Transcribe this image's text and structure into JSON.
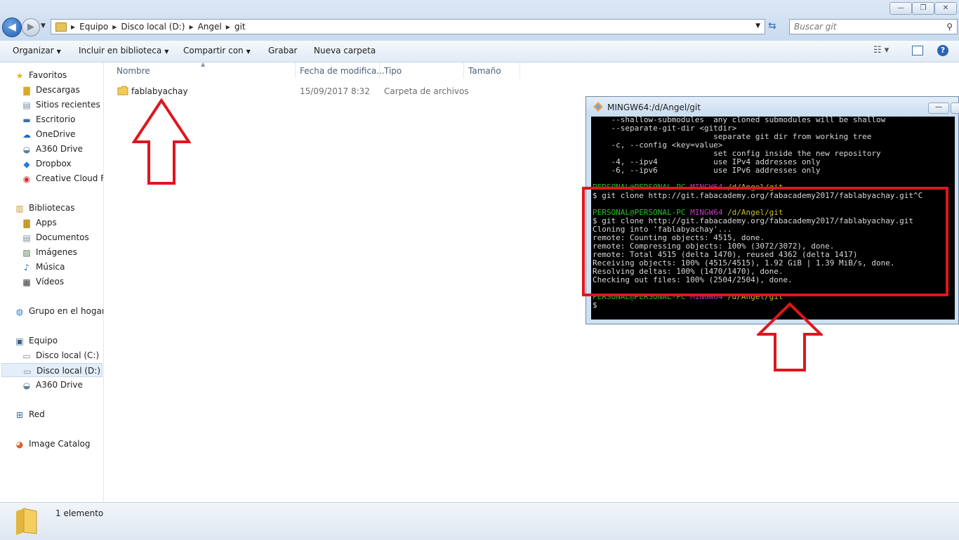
{
  "window": {
    "controls": {
      "minimize": "—",
      "maximize": "❐",
      "close": "✕"
    }
  },
  "address_bar": {
    "crumbs": [
      "Equipo",
      "Disco local (D:)",
      "Angel",
      "git"
    ],
    "search_placeholder": "Buscar git"
  },
  "toolbar": {
    "organize": "Organizar",
    "include_library": "Incluir en biblioteca",
    "share": "Compartir con",
    "burn": "Grabar",
    "new_folder": "Nueva carpeta"
  },
  "sidebar": {
    "favorites": {
      "label": "Favoritos",
      "items": [
        "Descargas",
        "Sitios recientes",
        "Escritorio",
        "OneDrive",
        "A360 Drive",
        "Dropbox",
        "Creative Cloud Files"
      ]
    },
    "libraries": {
      "label": "Bibliotecas",
      "items": [
        "Apps",
        "Documentos",
        "Imágenes",
        "Música",
        "Vídeos"
      ]
    },
    "homegroup": "Grupo en el hogar",
    "computer": {
      "label": "Equipo",
      "items": [
        "Disco local (C:)",
        "Disco local (D:)",
        "A360 Drive"
      ]
    },
    "network": "Red",
    "image_catalog": "Image Catalog"
  },
  "file_list": {
    "columns": [
      "Nombre",
      "Fecha de modifica...",
      "Tipo",
      "Tamaño"
    ],
    "rows": [
      {
        "name": "fablabyachay",
        "date": "15/09/2017 8:32",
        "type": "Carpeta de archivos",
        "size": ""
      }
    ]
  },
  "status_bar": {
    "count": "1 elemento"
  },
  "terminal": {
    "title": "MINGW64:/d/Angel/git",
    "prompt_user": "PERSONAL@PERSONAL-PC",
    "prompt_env": "MINGW64",
    "prompt_path": "/d/Angel/git",
    "help_lines": [
      "    --shallow-submodules  any cloned submodules will be shallow",
      "    --separate-git-dir <gitdir>",
      "                          separate git dir from working tree",
      "    -c, --config <key=value>",
      "                          set config inside the new repository",
      "    -4, --ipv4            use IPv4 addresses only",
      "    -6, --ipv6            use IPv6 addresses only"
    ],
    "command_cancelled": "$ git clone http://git.fabacademy.org/fabacademy2017/fablabyachay.git^C",
    "command": "$ git clone http://git.fabacademy.org/fabacademy2017/fablabyachay.git",
    "output_lines": [
      "Cloning into 'fablabyachay'...",
      "remote: Counting objects: 4515, done.",
      "remote: Compressing objects: 100% (3072/3072), done.",
      "remote: Total 4515 (delta 1470), reused 4362 (delta 1417)",
      "Receiving objects: 100% (4515/4515), 1.92 GiB | 1.39 MiB/s, done.",
      "Resolving deltas: 100% (1470/1470), done.",
      "Checking out files: 100% (2504/2504), done."
    ],
    "cursor_prompt": "$"
  },
  "colors": {
    "annotation_red": "#e0151c",
    "prompt_green": "#23c023",
    "prompt_magenta": "#c03ac0",
    "prompt_yellow": "#c9bd28"
  }
}
